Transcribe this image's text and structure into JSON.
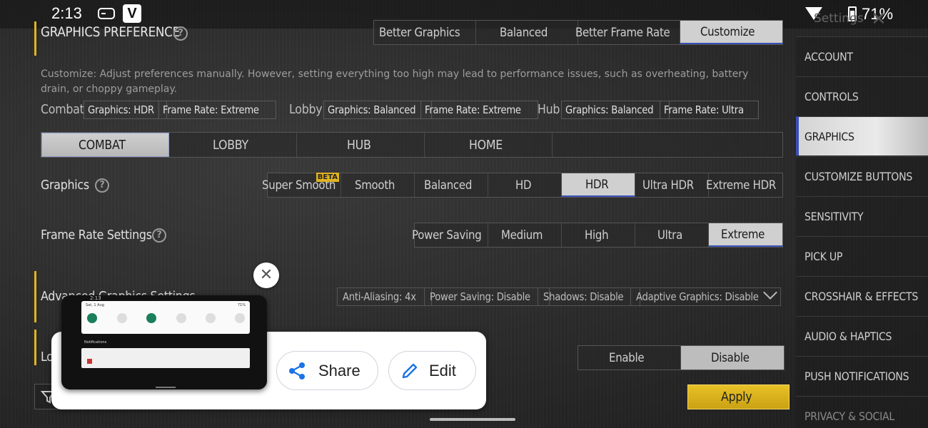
{
  "status": {
    "time": "2:13",
    "battery": "71%",
    "app_badge": "V"
  },
  "top": {
    "title": "Settings"
  },
  "graphics_pref": {
    "title": "GRAPHICS PREFERENCE",
    "options": [
      "Better Graphics",
      "Balanced",
      "Better Frame Rate",
      "Customize"
    ],
    "selected": "Customize",
    "description": "Customize: Adjust preferences manually. However, setting everything too high may lead to performance issues, such as overheating, battery drain, or choppy gameplay."
  },
  "summary": {
    "combat": {
      "label": "Combat",
      "graphics": "Graphics: HDR",
      "frame": "Frame Rate: Extreme"
    },
    "lobby": {
      "label": "Lobby",
      "graphics": "Graphics: Balanced",
      "frame": "Frame Rate: Extreme"
    },
    "hub": {
      "label": "Hub",
      "graphics": "Graphics: Balanced",
      "frame": "Frame Rate: Ultra"
    }
  },
  "mode_tabs": [
    "COMBAT",
    "LOBBY",
    "HUB",
    "HOME"
  ],
  "graphics_row": {
    "label": "Graphics",
    "options": [
      "Super Smooth",
      "Smooth",
      "Balanced",
      "HD",
      "HDR",
      "Ultra HDR",
      "Extreme HDR"
    ],
    "selected": "HDR",
    "beta": "BETA"
  },
  "frame_row": {
    "label": "Frame Rate Settings",
    "options": [
      "Power Saving",
      "Medium",
      "High",
      "Ultra",
      "Extreme"
    ],
    "selected": "Extreme"
  },
  "advanced": {
    "label": "Advanced Graphics Settings",
    "chips": [
      "Anti-Aliasing: 4x",
      "Power Saving: Disable",
      "Shadows: Disable",
      "Adaptive Graphics: Disable"
    ]
  },
  "toggle_row": {
    "label": "Lo",
    "options": [
      "Enable",
      "Disable"
    ],
    "selected": "Disable"
  },
  "sidebar": [
    "ACCOUNT",
    "CONTROLS",
    "GRAPHICS",
    "CUSTOMIZE BUTTONS",
    "SENSITIVITY",
    "PICK UP",
    "CROSSHAIR & EFFECTS",
    "AUDIO & HAPTICS",
    "PUSH NOTIFICATIONS",
    "PRIVACY & SOCIAL"
  ],
  "sidebar_selected": "GRAPHICS",
  "apply_label": "Apply",
  "screenshot_overlay": {
    "share_label": "Share",
    "edit_label": "Edit",
    "thumb_date": "Sat, 1 Aug",
    "thumb_battery": "71%",
    "thumb_time": "2:13",
    "thumb_notifications": "Notifications"
  },
  "colors": {
    "accent": "#e0b321",
    "selected_underline": "#3a50b8",
    "share_blue": "#1a73e8"
  }
}
